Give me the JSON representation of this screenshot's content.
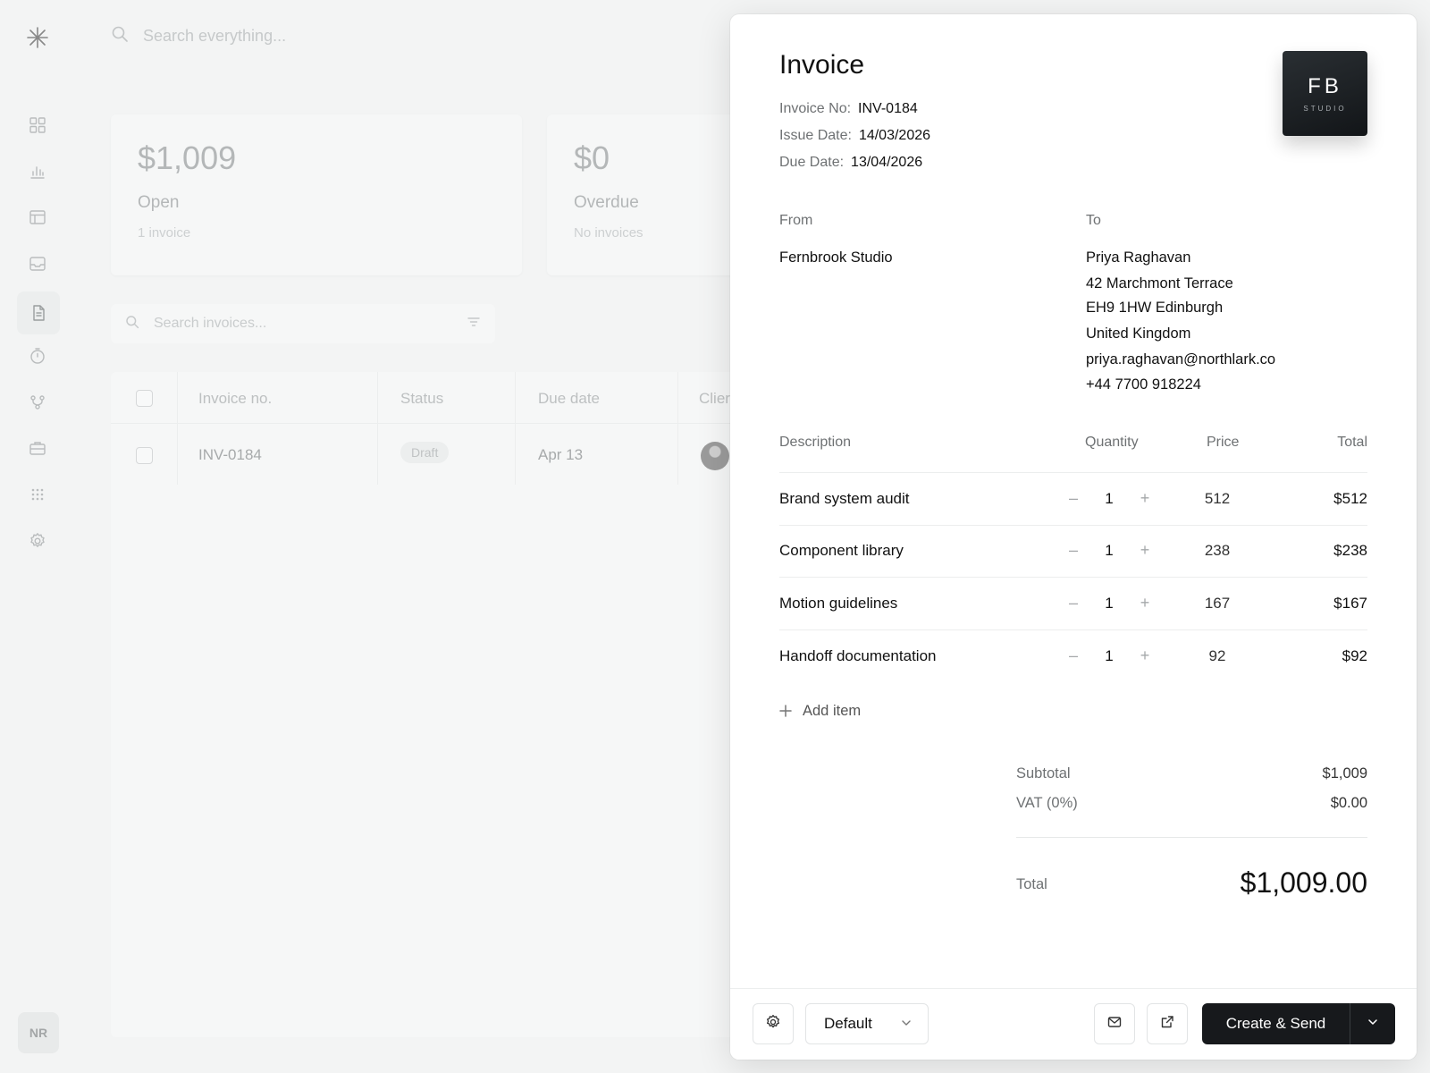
{
  "app": {
    "global_search_placeholder": "Search everything...",
    "user_initials": "NR"
  },
  "stats": [
    {
      "amount": "$1,009",
      "label": "Open",
      "sub": "1 invoice"
    },
    {
      "amount": "$0",
      "label": "Overdue",
      "sub": "No invoices"
    }
  ],
  "invoices_list": {
    "search_placeholder": "Search invoices...",
    "columns": [
      "Invoice no.",
      "Status",
      "Due date",
      "Clier"
    ],
    "rows": [
      {
        "number": "INV-0184",
        "status": "Draft",
        "due": "Apr 13"
      }
    ]
  },
  "invoice": {
    "title": "Invoice",
    "meta": [
      {
        "label": "Invoice No:",
        "value": "INV-0184"
      },
      {
        "label": "Issue Date:",
        "value": "14/03/2026"
      },
      {
        "label": "Due Date:",
        "value": "13/04/2026"
      }
    ],
    "logo": {
      "initials": "FB",
      "sub": "STUDIO"
    },
    "from_label": "From",
    "to_label": "To",
    "from": {
      "name": "Fernbrook Studio"
    },
    "to": {
      "name": "Priya Raghavan",
      "address1": "42 Marchmont Terrace",
      "address2": "EH9 1HW Edinburgh",
      "country": "United Kingdom",
      "email": "priya.raghavan@northlark.co",
      "phone": "+44 7700 918224"
    },
    "columns": {
      "description": "Description",
      "quantity": "Quantity",
      "price": "Price",
      "total": "Total"
    },
    "items": [
      {
        "description": "Brand system audit",
        "quantity": "1",
        "price": "512",
        "total": "$512"
      },
      {
        "description": "Component library",
        "quantity": "1",
        "price": "238",
        "total": "$238"
      },
      {
        "description": "Motion guidelines",
        "quantity": "1",
        "price": "167",
        "total": "$167"
      },
      {
        "description": "Handoff documentation",
        "quantity": "1",
        "price": "92",
        "total": "$92"
      }
    ],
    "stepper": {
      "minus": "–",
      "plus": "+"
    },
    "add_item_label": "Add item",
    "subtotal_label": "Subtotal",
    "subtotal": "$1,009",
    "vat_label": "VAT  (0%)",
    "vat": "$0.00",
    "total_label": "Total",
    "total": "$1,009.00"
  },
  "footer": {
    "template_value": "Default",
    "primary_label": "Create & Send"
  }
}
